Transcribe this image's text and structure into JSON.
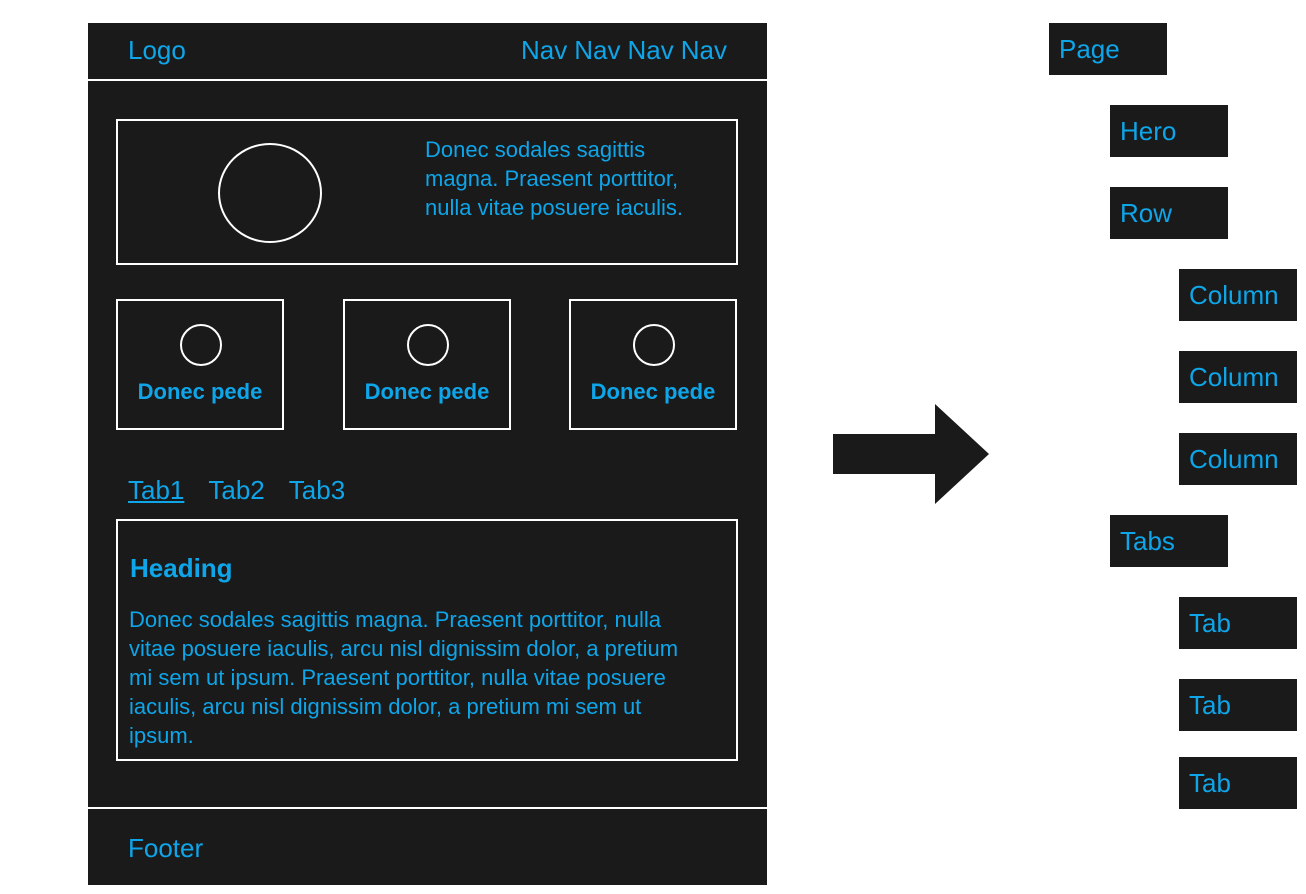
{
  "wireframe": {
    "header": {
      "logo": "Logo",
      "nav": [
        "Nav",
        "Nav",
        "Nav",
        "Nav"
      ]
    },
    "hero": {
      "text": "Donec sodales sagittis magna. Praesent porttitor, nulla vitae posuere iaculis."
    },
    "columns": [
      "Donec pede",
      "Donec pede",
      "Donec pede"
    ],
    "tabs": [
      "Tab1",
      "Tab2",
      "Tab3"
    ],
    "content": {
      "heading": "Heading",
      "body": "Donec sodales sagittis magna. Praesent porttitor, nulla vitae posuere iaculis, arcu nisl dignissim dolor, a pretium mi sem ut ipsum. Praesent porttitor, nulla vitae posuere iaculis, arcu nisl dignissim dolor, a pretium mi sem ut ipsum."
    },
    "footer": "Footer"
  },
  "tree": [
    {
      "label": "Page",
      "level": 0
    },
    {
      "label": "Hero",
      "level": 1
    },
    {
      "label": "Row",
      "level": 1
    },
    {
      "label": "Column",
      "level": 2
    },
    {
      "label": "Column",
      "level": 2
    },
    {
      "label": "Column",
      "level": 2
    },
    {
      "label": "Tabs",
      "level": 1
    },
    {
      "label": "Tab",
      "level": 2
    },
    {
      "label": "Tab",
      "level": 2
    },
    {
      "label": "Tab",
      "level": 2
    }
  ],
  "colors": {
    "background": "#1a1a1a",
    "text": "#0ea5e9",
    "lines": "#ffffff"
  }
}
